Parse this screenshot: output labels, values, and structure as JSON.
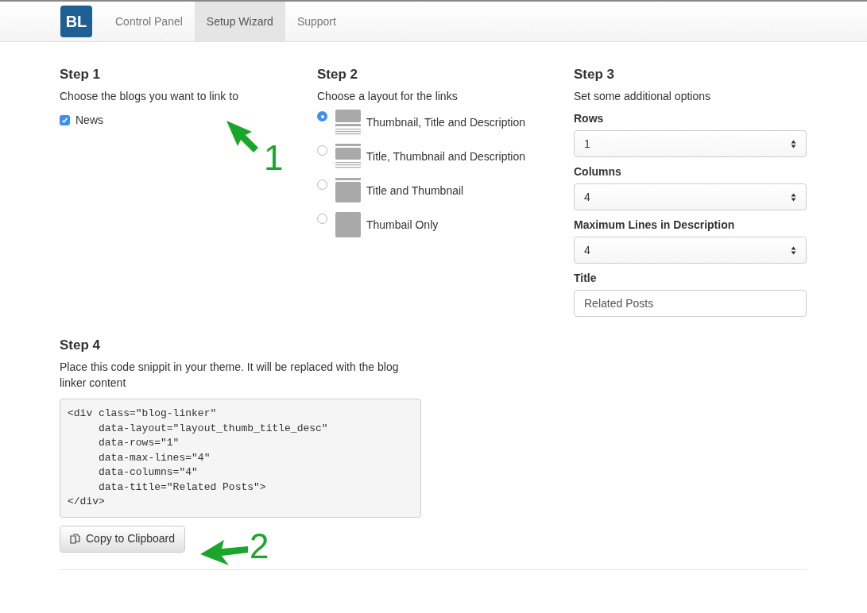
{
  "navbar": {
    "logo": "BL",
    "tabs": [
      {
        "label": "Control Panel",
        "selected": false
      },
      {
        "label": "Setup Wizard",
        "selected": true
      },
      {
        "label": "Support",
        "selected": false
      }
    ]
  },
  "step1": {
    "heading": "Step 1",
    "description": "Choose the blogs you want to link to",
    "blogs": [
      {
        "label": "News",
        "checked": true
      }
    ]
  },
  "step2": {
    "heading": "Step 2",
    "description": "Choose a layout for the links",
    "layouts": [
      {
        "kind": "thumb_title_desc",
        "label": "Thumbnail, Title and Description",
        "selected": true
      },
      {
        "kind": "title_thumb_desc",
        "label": "Title, Thumbnail and Description",
        "selected": false
      },
      {
        "kind": "title_thumb",
        "label": "Title and Thumbnail",
        "selected": false
      },
      {
        "kind": "thumb",
        "label": "Thumbail Only",
        "selected": false
      }
    ]
  },
  "step3": {
    "heading": "Step 3",
    "description": "Set some additional options",
    "fields": [
      {
        "kind": "select",
        "label": "Rows",
        "value": "1"
      },
      {
        "kind": "select",
        "label": "Columns",
        "value": "4"
      },
      {
        "kind": "select",
        "label": "Maximum Lines in Description",
        "value": "4"
      },
      {
        "kind": "text",
        "label": "Title",
        "value": "Related Posts"
      }
    ]
  },
  "step4": {
    "heading": "Step 4",
    "description": "Place this code snippit in your theme. It will be replaced with the blog linker content",
    "code_lines": [
      "<div class=\"blog-linker\"",
      "     data-layout=\"layout_thumb_title_desc\"",
      "     data-rows=\"1\"",
      "     data-max-lines=\"4\"",
      "     data-columns=\"4\"",
      "     data-title=\"Related Posts\">",
      "</div>"
    ],
    "copy_button": "Copy to Clipboard"
  },
  "annotations": [
    {
      "label": "1"
    },
    {
      "label": "2"
    }
  ]
}
